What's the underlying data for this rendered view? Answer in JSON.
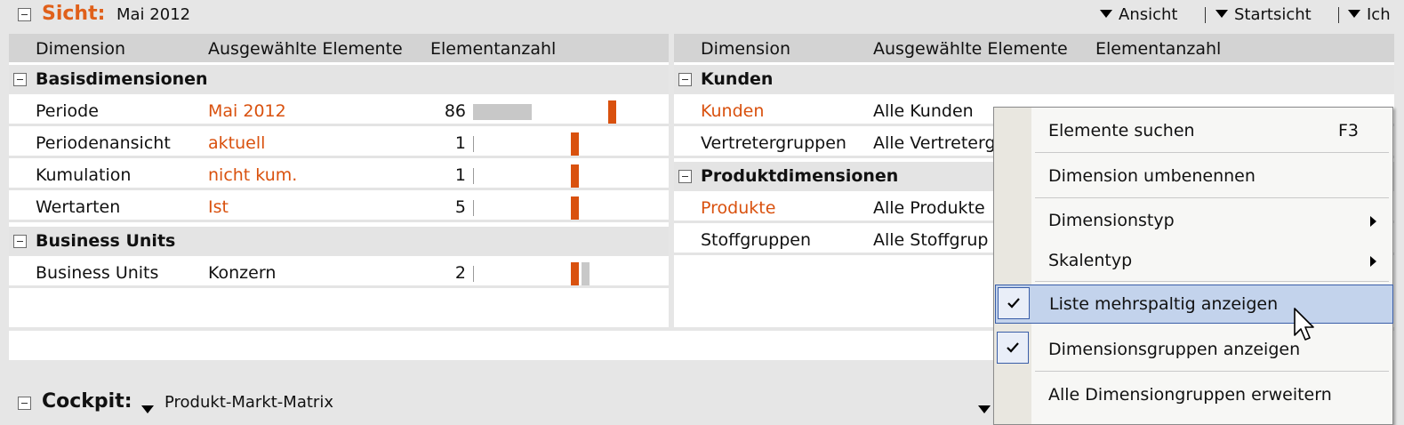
{
  "header": {
    "sicht_label": "Sicht:",
    "sicht_value": "Mai 2012",
    "menus": [
      "Ansicht",
      "Startsicht",
      "Ich"
    ]
  },
  "left_panel": {
    "columns": [
      "Dimension",
      "Ausgewählte Elemente",
      "Elementanzahl"
    ],
    "groups": [
      {
        "name": "Basisdimensionen",
        "rows": [
          {
            "dimension": "Periode",
            "selected": "Mai 2012",
            "count": "86"
          },
          {
            "dimension": "Periodenansicht",
            "selected": "aktuell",
            "count": "1"
          },
          {
            "dimension": "Kumulation",
            "selected": "nicht kum.",
            "count": "1"
          },
          {
            "dimension": "Wertarten",
            "selected": "Ist",
            "count": "5"
          }
        ]
      },
      {
        "name": "Business Units",
        "rows": [
          {
            "dimension": "Business Units",
            "selected": "Konzern",
            "count": "2"
          }
        ]
      }
    ]
  },
  "right_panel": {
    "columns": [
      "Dimension",
      "Ausgewählte Elemente",
      "Elementanzahl"
    ],
    "groups": [
      {
        "name": "Kunden",
        "rows": [
          {
            "dimension": "Kunden",
            "selected": "Alle Kunden"
          },
          {
            "dimension": "Vertretergruppen",
            "selected": "Alle Vertreterg"
          }
        ]
      },
      {
        "name": "Produktdimensionen",
        "rows": [
          {
            "dimension": "Produkte",
            "selected": "Alle Produkte"
          },
          {
            "dimension": "Stoffgruppen",
            "selected": "Alle Stoffgrup"
          }
        ]
      }
    ]
  },
  "cockpit": {
    "label": "Cockpit:",
    "value": "Produkt-Markt-Matrix"
  },
  "context_menu": {
    "items": [
      {
        "label": "Elemente suchen",
        "shortcut": "F3"
      },
      {
        "label": "Dimension umbenennen"
      },
      {
        "label": "Dimensionstyp"
      },
      {
        "label": "Skalentyp"
      },
      {
        "label": "Liste mehrspaltig anzeigen",
        "checked": "true"
      },
      {
        "label": "Dimensionsgruppen anzeigen",
        "checked": "true"
      },
      {
        "label": "Alle Dimensiongruppen erweitern"
      }
    ]
  },
  "colors": {
    "accent_orange": "#d9510e",
    "title_orange": "#e0601a",
    "highlight": "#c3d3ec",
    "highlight_border": "#3a5ea8"
  }
}
